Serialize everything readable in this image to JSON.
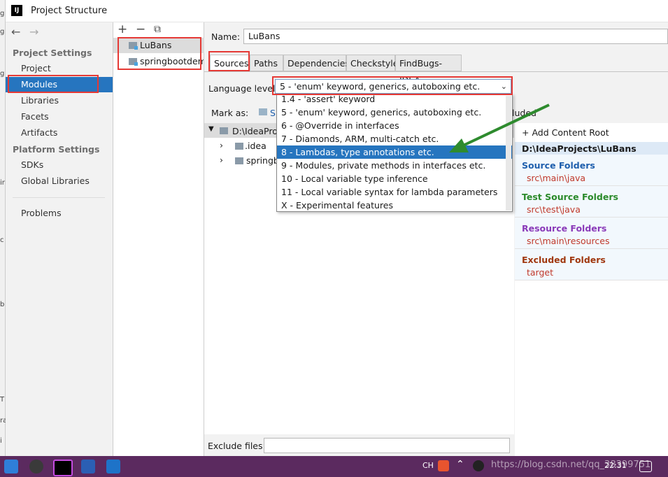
{
  "window": {
    "title": "Project Structure",
    "logo_text": "IJ"
  },
  "left_strip_chars": [
    "g",
    "g",
    "g",
    "ir",
    "c",
    "b",
    "T",
    "ra",
    "i"
  ],
  "nav": {
    "back_arrow": "←",
    "forward_arrow": "→",
    "project_settings_header": "Project Settings",
    "project_items": [
      "Project",
      "Modules",
      "Libraries",
      "Facets",
      "Artifacts"
    ],
    "platform_settings_header": "Platform Settings",
    "platform_items": [
      "SDKs",
      "Global Libraries"
    ],
    "problems": "Problems",
    "selected": "Modules"
  },
  "modules": {
    "toolbar": {
      "add": "+",
      "remove": "−",
      "copy": "⧉"
    },
    "items": [
      "LuBans",
      "springbootdem"
    ]
  },
  "main": {
    "name_label": "Name:",
    "name_value": "LuBans",
    "tabs": [
      "Sources",
      "Paths",
      "Dependencies",
      "Checkstyle",
      "FindBugs-IDEA"
    ],
    "active_tab": "Sources",
    "language_level_label": "Language level:",
    "language_level_value": "5 - 'enum' keyword, generics, autoboxing etc.",
    "language_options": [
      "1.4 - 'assert' keyword",
      "5 - 'enum' keyword, generics, autoboxing etc.",
      "6 - @Override in interfaces",
      "7 - Diamonds, ARM, multi-catch etc.",
      "8 - Lambdas, type annotations etc.",
      "9 - Modules, private methods in interfaces etc.",
      "10 - Local variable type inference",
      "11 - Local variable syntax for lambda parameters",
      "X - Experimental features"
    ],
    "highlighted_option": "8 - Lambdas, type annotations etc.",
    "mark_as_label": "Mark as:",
    "mark_as_first": "S",
    "mark_as_trailing": "luded",
    "tree_root": "D:\\IdeaProj",
    "tree_children": [
      ".idea",
      "springb"
    ],
    "exclude_files_label": "Exclude files:",
    "exclude_files_value": ""
  },
  "content_root": {
    "add_label": "+ Add Content Root",
    "path": "D:\\IdeaProjects\\LuBans",
    "source_header": "Source Folders",
    "source_path": "src\\main\\java",
    "test_header": "Test Source Folders",
    "test_path": "src\\test\\java",
    "resource_header": "Resource Folders",
    "resource_path": "src\\main\\resources",
    "excluded_header": "Excluded Folders",
    "excluded_path": "target"
  },
  "colors": {
    "selection": "#2675bf",
    "annotation_red": "#e53935",
    "arrow_green": "#2e8b2e",
    "source": "#1f5fad",
    "test": "#2a8a2a",
    "resource": "#8a3ab9",
    "excluded": "#a0380f",
    "path_red": "#c0392b",
    "taskbar": "#5b2a5f"
  },
  "taskbar": {
    "tray_lang": "CH",
    "tray_time": "22:31",
    "watermark": "https://blog.csdn.net/qq_38399751"
  }
}
